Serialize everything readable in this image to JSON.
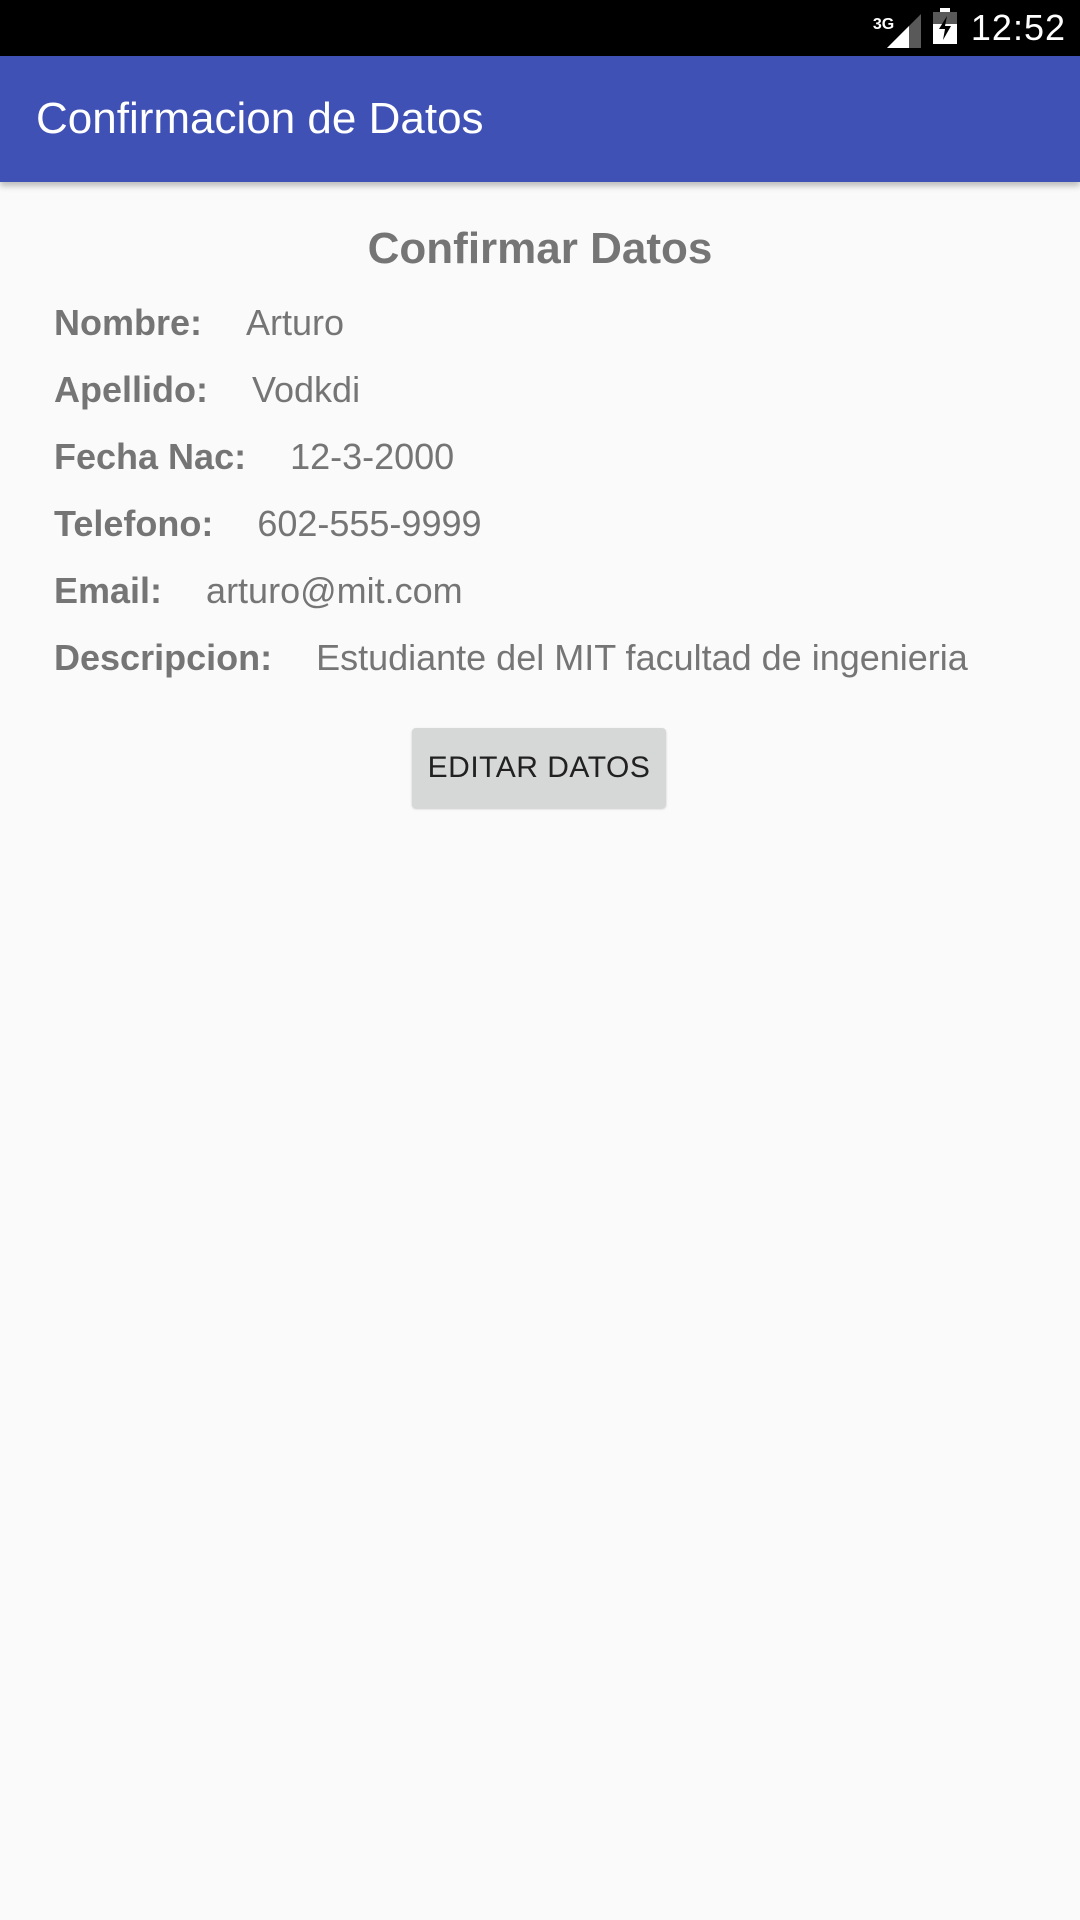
{
  "status_bar": {
    "network": "3G",
    "time": "12:52",
    "icons": [
      "signal-icon",
      "battery-icon"
    ]
  },
  "app_bar": {
    "title": "Confirmacion de Datos",
    "color": "#3f51b5"
  },
  "main": {
    "heading": "Confirmar Datos",
    "fields": [
      {
        "label": "Nombre:",
        "value": "Arturo"
      },
      {
        "label": "Apellido:",
        "value": "Vodkdi"
      },
      {
        "label": "Fecha Nac:",
        "value": "12-3-2000"
      },
      {
        "label": "Telefono:",
        "value": "602-555-9999"
      },
      {
        "label": "Email:",
        "value": "arturo@mit.com"
      },
      {
        "label": "Descripcion:",
        "value": "Estudiante del MIT facultad de ingenieria"
      }
    ],
    "edit_button_label": "EDITAR DATOS"
  }
}
